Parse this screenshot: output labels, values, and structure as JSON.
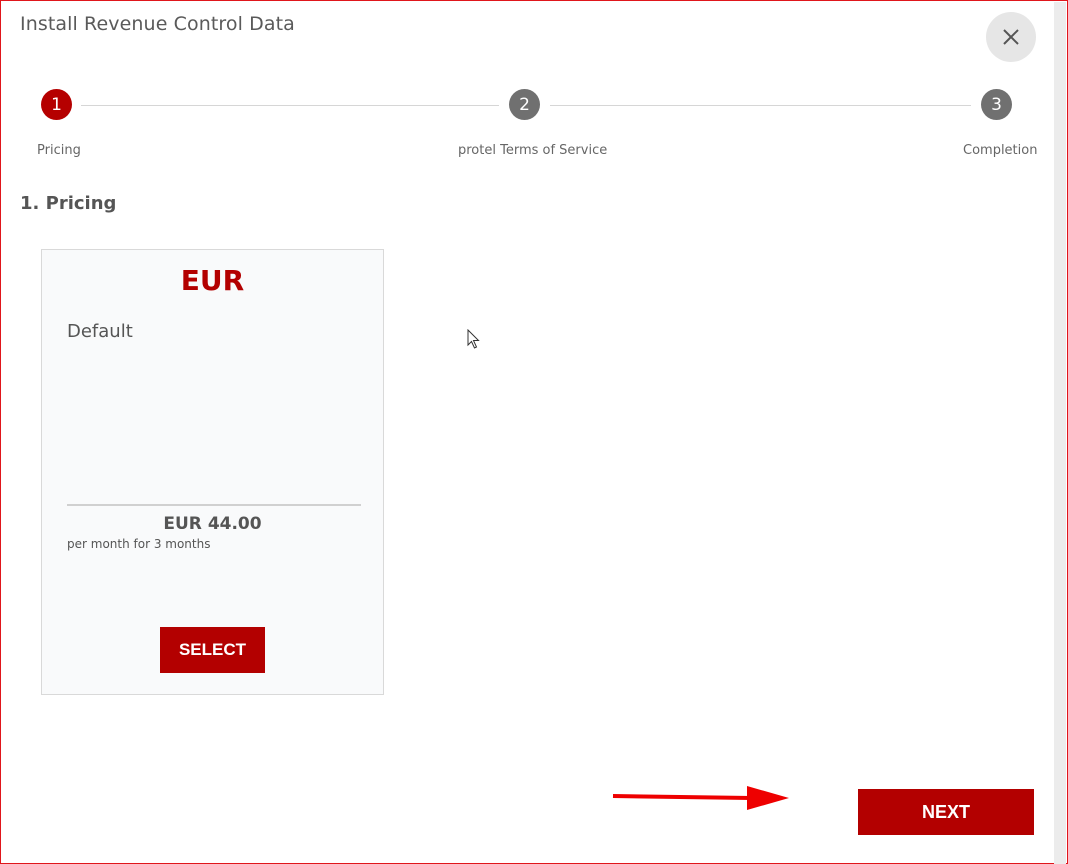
{
  "dialog": {
    "title": "Install Revenue Control Data",
    "close_icon": "close-icon"
  },
  "stepper": {
    "steps": [
      {
        "number": "1",
        "label": "Pricing",
        "state": "active"
      },
      {
        "number": "2",
        "label": "protel Terms of Service",
        "state": "inactive"
      },
      {
        "number": "3",
        "label": "Completion",
        "state": "inactive"
      }
    ]
  },
  "section": {
    "title": "1. Pricing"
  },
  "price_card": {
    "currency": "EUR",
    "plan_name": "Default",
    "price": "EUR 44.00",
    "price_note": "per month for 3 months",
    "select_label": "SELECT"
  },
  "footer": {
    "next_label": "NEXT"
  },
  "colors": {
    "accent": "#b30000",
    "annotation_arrow": "#ee0000",
    "inactive_step": "#707070"
  }
}
